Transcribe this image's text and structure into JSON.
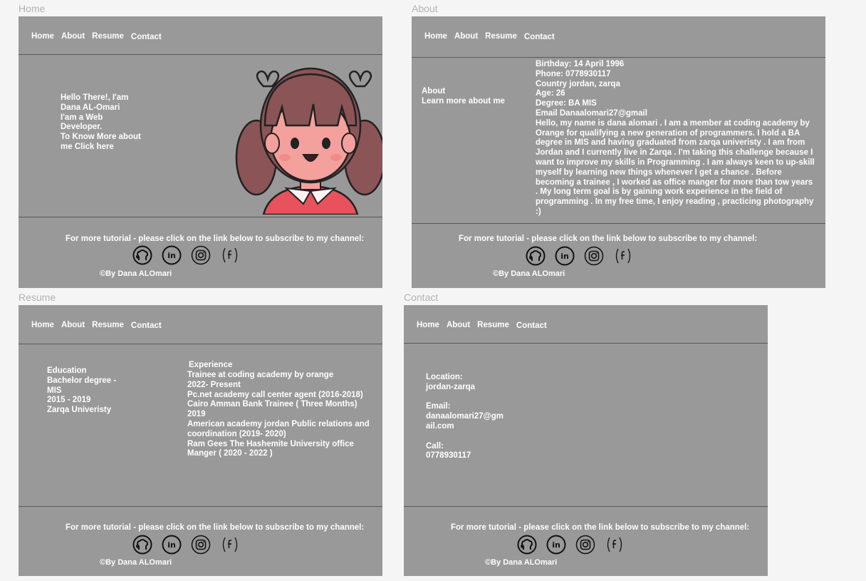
{
  "frames": {
    "home_label": "Home",
    "about_label": "About",
    "resume_label": "Resume",
    "contact_label": "Contact"
  },
  "nav": {
    "home": "Home",
    "about": "About",
    "resume": "Resume",
    "contact": "Contact"
  },
  "home": {
    "intro": "Hello There!, I'am\nDana AL-Omari\nI'am a Web\nDeveloper.\nTo Know More about\nme Click here"
  },
  "about": {
    "heading": "About\nLearn more about me",
    "details": "Birthday: 14 April 1996\nPhone: 0778930117\nCountry jordan, zarqa\nAge: 26\nDegree: BA MIS\nEmail Danaalomari27@gmail\nHello, my name is dana alomari . I am a member at coding academy by\nOrange for qualifying a new generation of programmers. I hold a BA\ndegree in MIS and having graduated from zarqa univeristy . I am from\nJordan and I currently live in Zarqa . I'm taking this challenge because I\nwant to improve my skills in Programming . I am always keen to up-skill\nmyself by learning new things whenever I get a chance . Before\nbecoming a trainee , I worked as office manger for more than tow years\n. My long term goal is by gaining work experience in the field of\nprogramming . In my free time, I enjoy reading , practicing photography\n:)"
  },
  "resume": {
    "education": "Education\nBachelor degree -\nMIS\n2015 - 2019\nZarqa Univeristy",
    "experience_title": "Experience",
    "experience": "Trainee at coding academy by orange\n2022- Present\nPc.net academy call center agent (2016-2018)\nCairo Amman Bank Trainee ( Three Months)\n2019\nAmerican academy jordan Public relations and\ncoordination (2019- 2020)\nRam Gees The Hashemite University office\nManger ( 2020 - 2022 )"
  },
  "contact": {
    "details": "Location:\njordan-zarqa\n\nEmail:\ndanaalomari27@gm\nail.com\n\nCall:\n0778930117"
  },
  "footer": {
    "tagline": "For more tutorial - please click on the link below to subscribe to my channel:",
    "copyright": "©By Dana ALOmari",
    "icons": [
      "github-icon",
      "linkedin-icon",
      "instagram-icon",
      "facebook-icon"
    ]
  },
  "colors": {
    "page_bg": "#f5f5f5",
    "frame_bg": "#999999",
    "divider": "#5a5a5a",
    "text": "#ffffff",
    "label": "#b3b3b3"
  }
}
